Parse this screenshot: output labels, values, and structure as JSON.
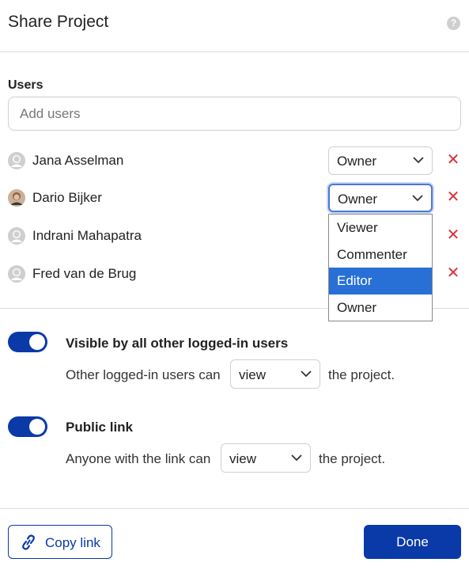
{
  "dialog": {
    "title": "Share Project",
    "help_icon": "question-circle-icon"
  },
  "users_section": {
    "label": "Users",
    "add_users_placeholder": "Add users",
    "users": [
      {
        "name": "Jana Asselman",
        "role": "Owner",
        "avatar": "default-avatar"
      },
      {
        "name": "Dario Bijker",
        "role": "Owner",
        "avatar": "photo-avatar"
      },
      {
        "name": "Indrani Mahapatra",
        "role": "",
        "avatar": "default-avatar"
      },
      {
        "name": "Fred van de Brug",
        "role": "",
        "avatar": "default-avatar"
      }
    ],
    "remove_icon": "close-x-icon",
    "remove_color": "#d8323b"
  },
  "role_dropdown": {
    "options": [
      "Viewer",
      "Commenter",
      "Editor",
      "Owner"
    ],
    "highlighted": "Editor"
  },
  "visibility": {
    "logged_in": {
      "enabled": true,
      "title": "Visible by all other logged-in users",
      "prefix": "Other logged-in users can",
      "permission": "view",
      "suffix": "the project."
    },
    "public_link": {
      "enabled": true,
      "title": "Public link",
      "prefix": "Anyone with the link can",
      "permission": "view",
      "suffix": "the project."
    }
  },
  "footer": {
    "copy_link_label": "Copy link",
    "copy_link_icon": "link-icon",
    "done_label": "Done"
  },
  "colors": {
    "primary": "#0a3aa8",
    "highlight": "#2870d6",
    "danger": "#d8323b"
  }
}
